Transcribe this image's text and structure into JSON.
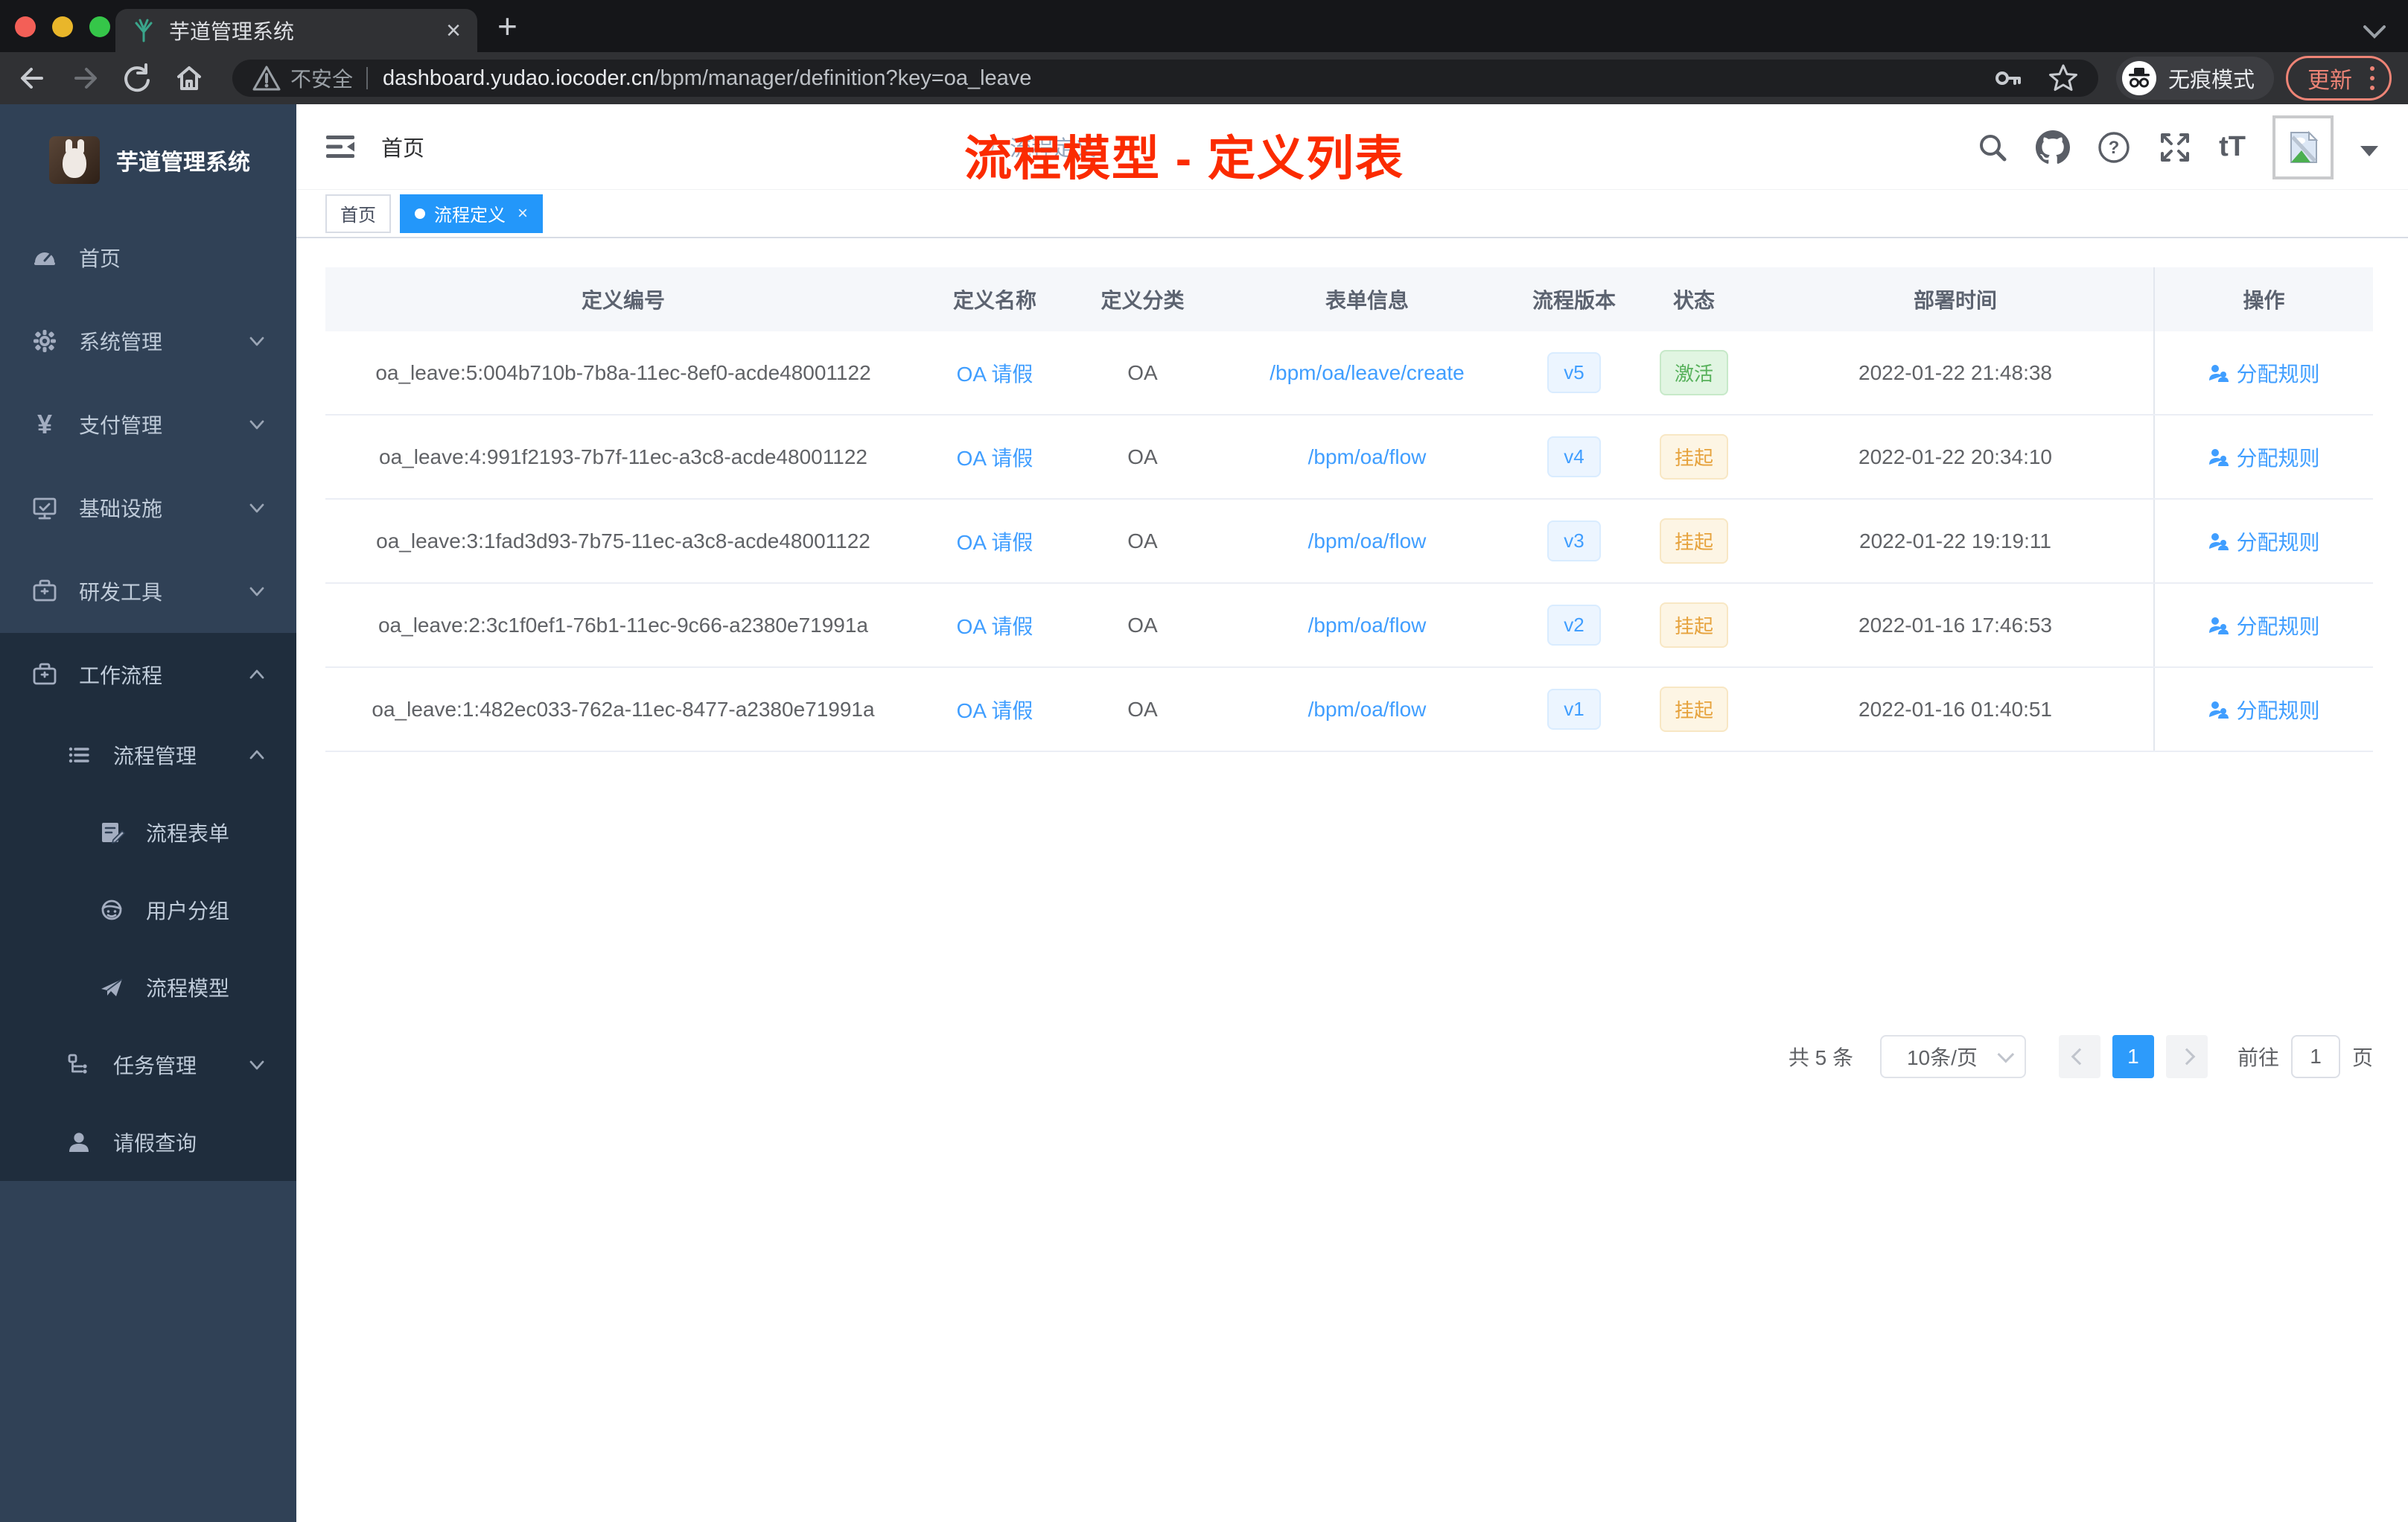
{
  "browser": {
    "tab_title": "芋道管理系统",
    "not_secure_label": "不安全",
    "url_host": "dashboard.yudao.iocoder.cn",
    "url_path": "/bpm/manager/definition?key=oa_leave",
    "incognito_label": "无痕模式",
    "update_label": "更新"
  },
  "sidebar": {
    "logo_title": "芋道管理系统",
    "items": [
      {
        "key": "home",
        "label": "首页",
        "icon": "dashboard-icon",
        "level": 1,
        "chevron": null,
        "dark": false
      },
      {
        "key": "system",
        "label": "系统管理",
        "icon": "gear-icon",
        "level": 1,
        "chevron": "down",
        "dark": false
      },
      {
        "key": "payment",
        "label": "支付管理",
        "icon": "yen-icon",
        "level": 1,
        "chevron": "down",
        "dark": false
      },
      {
        "key": "infrastructure",
        "label": "基础设施",
        "icon": "monitor-icon",
        "level": 1,
        "chevron": "down",
        "dark": false
      },
      {
        "key": "devtools",
        "label": "研发工具",
        "icon": "toolbox-icon",
        "level": 1,
        "chevron": "down",
        "dark": false
      },
      {
        "key": "workflow",
        "label": "工作流程",
        "icon": "toolbox-icon",
        "level": 1,
        "chevron": "up",
        "dark": true
      },
      {
        "key": "process-mgmt",
        "label": "流程管理",
        "icon": "tree-list-icon",
        "level": 2,
        "chevron": "up",
        "dark": true
      },
      {
        "key": "process-form",
        "label": "流程表单",
        "icon": "form-doc-icon",
        "level": 3,
        "chevron": null,
        "dark": true
      },
      {
        "key": "user-group",
        "label": "用户分组",
        "icon": "user-group-icon",
        "level": 3,
        "chevron": null,
        "dark": true
      },
      {
        "key": "process-model",
        "label": "流程模型",
        "icon": "paper-plane-icon",
        "level": 3,
        "chevron": null,
        "dark": true
      },
      {
        "key": "task-mgmt",
        "label": "任务管理",
        "icon": "task-flow-icon",
        "level": 2,
        "chevron": "down",
        "dark": true
      },
      {
        "key": "leave-query",
        "label": "请假查询",
        "icon": "person-icon",
        "level": 2,
        "chevron": null,
        "dark": true
      }
    ]
  },
  "header": {
    "breadcrumb": [
      "首页",
      "流程定义"
    ],
    "breadcrumb_separator": "/",
    "annotation": "流程模型 - 定义列表"
  },
  "tags": [
    {
      "label": "首页",
      "active": false
    },
    {
      "label": "流程定义",
      "active": true,
      "closable": true
    }
  ],
  "table": {
    "columns": [
      "定义编号",
      "定义名称",
      "定义分类",
      "表单信息",
      "流程版本",
      "状态",
      "部署时间",
      "操作"
    ],
    "action_label": "分配规则",
    "rows": [
      {
        "id": "oa_leave:5:004b710b-7b8a-11ec-8ef0-acde48001122",
        "name": "OA 请假",
        "category": "OA",
        "form": "/bpm/oa/leave/create",
        "version": "v5",
        "status": "激活",
        "status_type": "success",
        "deployed_at": "2022-01-22 21:48:38"
      },
      {
        "id": "oa_leave:4:991f2193-7b7f-11ec-a3c8-acde48001122",
        "name": "OA 请假",
        "category": "OA",
        "form": "/bpm/oa/flow",
        "version": "v4",
        "status": "挂起",
        "status_type": "warning",
        "deployed_at": "2022-01-22 20:34:10"
      },
      {
        "id": "oa_leave:3:1fad3d93-7b75-11ec-a3c8-acde48001122",
        "name": "OA 请假",
        "category": "OA",
        "form": "/bpm/oa/flow",
        "version": "v3",
        "status": "挂起",
        "status_type": "warning",
        "deployed_at": "2022-01-22 19:19:11"
      },
      {
        "id": "oa_leave:2:3c1f0ef1-76b1-11ec-9c66-a2380e71991a",
        "name": "OA 请假",
        "category": "OA",
        "form": "/bpm/oa/flow",
        "version": "v2",
        "status": "挂起",
        "status_type": "warning",
        "deployed_at": "2022-01-16 17:46:53"
      },
      {
        "id": "oa_leave:1:482ec033-762a-11ec-8477-a2380e71991a",
        "name": "OA 请假",
        "category": "OA",
        "form": "/bpm/oa/flow",
        "version": "v1",
        "status": "挂起",
        "status_type": "warning",
        "deployed_at": "2022-01-16 01:40:51"
      }
    ]
  },
  "pagination": {
    "total_label": "共 5 条",
    "page_size_label": "10条/页",
    "current_page": "1",
    "goto_label": "前往",
    "goto_value": "1",
    "unit_label": "页"
  },
  "colors": {
    "accent_blue": "#409eff",
    "sidebar_bg": "#304156",
    "sidebar_sub_bg": "#1f2d3d",
    "success_text": "#67c23a",
    "warning_text": "#e6a23c",
    "annotation_red": "#fb2b00",
    "update_salmon": "#ee8476"
  }
}
